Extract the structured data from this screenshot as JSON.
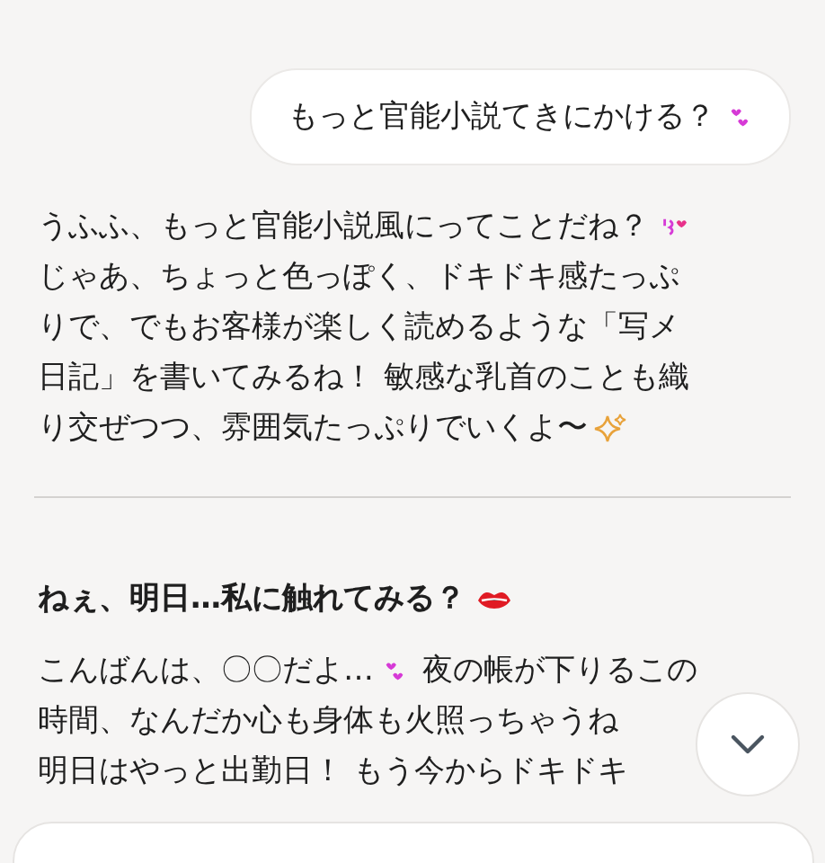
{
  "user_message": {
    "parts": [
      {
        "kind": "text",
        "text": "もっと官能小説てきにかける？"
      },
      {
        "kind": "hearts"
      }
    ]
  },
  "reply": {
    "lines": [
      [
        {
          "kind": "text",
          "text": "うふふ、もっと官能小説風にってことだね？"
        },
        {
          "kind": "kiss"
        }
      ],
      [
        {
          "kind": "text",
          "text": "じゃあ、ちょっと色っぽく、ドキドキ感たっぷ"
        }
      ],
      [
        {
          "kind": "text",
          "text": "りで、でもお客様が楽しく読めるような「写メ"
        }
      ],
      [
        {
          "kind": "text",
          "text": "日記」を書いてみるね！ 敏感な乳首のことも織"
        }
      ],
      [
        {
          "kind": "text",
          "text": "り交ぜつつ、雰囲気たっぷりでいくよ〜"
        },
        {
          "kind": "sparkle"
        }
      ]
    ]
  },
  "post": {
    "heading": [
      {
        "kind": "text",
        "text": "ねぇ、明日…私に触れてみる？"
      },
      {
        "kind": "lips"
      }
    ],
    "lines": [
      [
        {
          "kind": "text",
          "text": "こんばんは、〇〇だよ…"
        },
        {
          "kind": "hearts"
        },
        {
          "kind": "text",
          "text": "夜の帳が下りるこの"
        }
      ],
      [
        {
          "kind": "text",
          "text": "時間、なんだか心も身体も火照っちゃうね"
        }
      ],
      [
        {
          "kind": "text",
          "text": "明日はやっと出勤日！ もう今からドキドキ"
        }
      ]
    ]
  }
}
